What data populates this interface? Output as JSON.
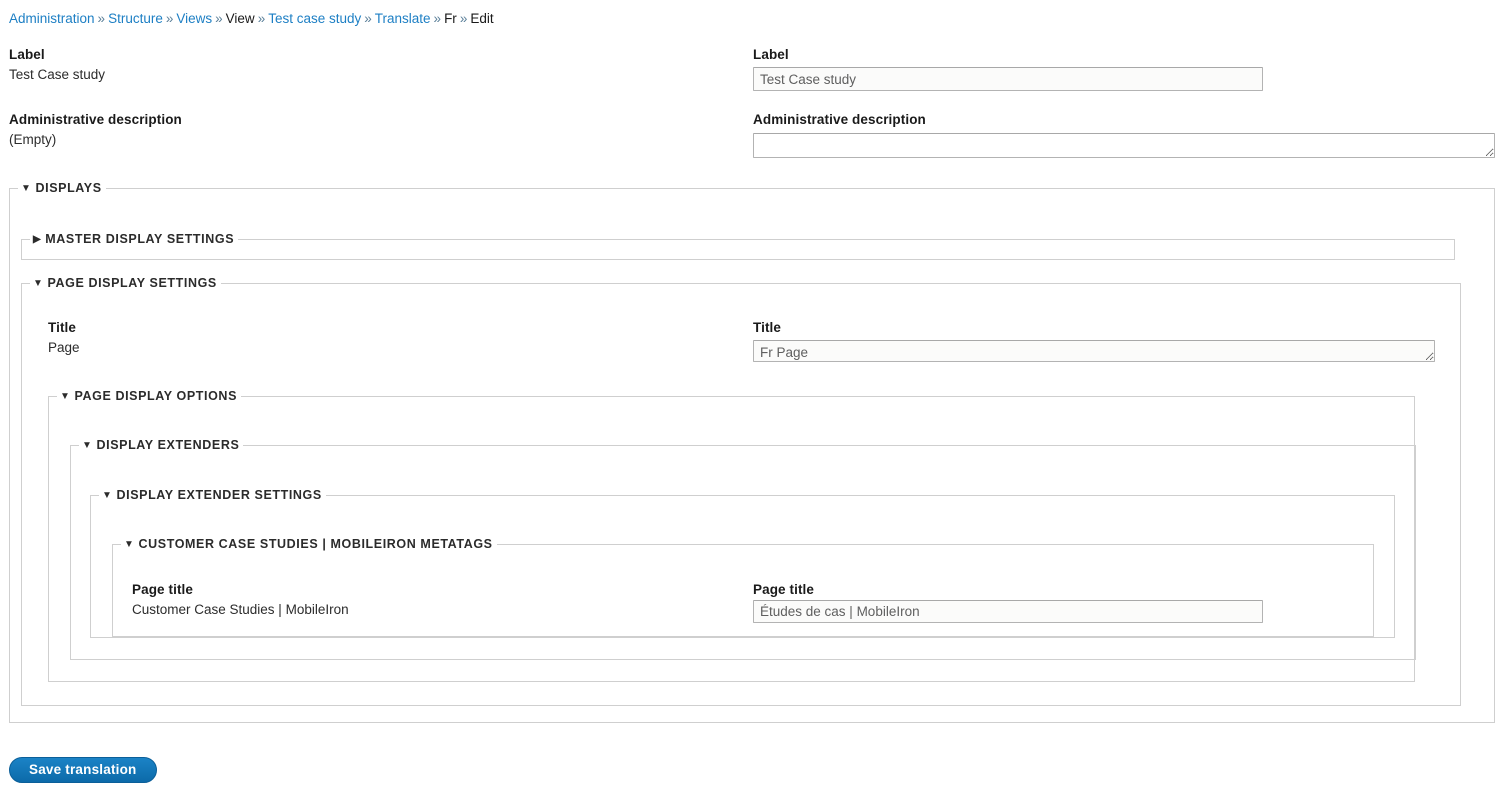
{
  "breadcrumb": {
    "separator": "»",
    "items": [
      {
        "label": "Administration",
        "link": true
      },
      {
        "label": "Structure",
        "link": true
      },
      {
        "label": "Views",
        "link": true
      },
      {
        "label": "View",
        "link": false
      },
      {
        "label": "Test case study",
        "link": true
      },
      {
        "label": "Translate",
        "link": true
      },
      {
        "label": "Fr",
        "link": false
      },
      {
        "label": "Edit",
        "link": false
      }
    ]
  },
  "colors": {
    "link": "#1d7fc4",
    "button_primary": "#0f73b5",
    "fieldset_border": "#cfcfcf",
    "input_border": "#b3b3b3",
    "input_background": "#fbfbfa",
    "legend_text": "#2b2b2b"
  },
  "fields": {
    "label": {
      "source_label": "Label",
      "source_value": "Test Case study",
      "translation_label": "Label",
      "translation_value": "Test Case study"
    },
    "admin_description": {
      "source_label": "Administrative description",
      "source_value": "(Empty)",
      "translation_label": "Administrative description",
      "translation_value": ""
    },
    "title": {
      "source_label": "Title",
      "source_value": "Page",
      "translation_label": "Title",
      "translation_value": "Fr Page"
    },
    "page_title": {
      "source_label": "Page title",
      "source_value": "Customer Case Studies | MobileIron",
      "translation_label": "Page title",
      "translation_value": "Études de cas | MobileIron"
    }
  },
  "fieldsets": {
    "displays": {
      "legend": "Displays",
      "state": "open",
      "marker": "▼"
    },
    "master_display_settings": {
      "legend": "Master display settings",
      "state": "collapsed",
      "marker": "▶"
    },
    "page_display_settings": {
      "legend": "Page display settings",
      "state": "open",
      "marker": "▼"
    },
    "page_display_options": {
      "legend": "Page display options",
      "state": "open",
      "marker": "▼"
    },
    "display_extenders": {
      "legend": "Display extenders",
      "state": "open",
      "marker": "▼"
    },
    "display_extender_settings": {
      "legend": "Display extender settings",
      "state": "open",
      "marker": "▼"
    },
    "metatags": {
      "legend": "Customer Case Studies | MobileIron metatags",
      "state": "open",
      "marker": "▼"
    }
  },
  "actions": {
    "save_label": "Save translation"
  }
}
